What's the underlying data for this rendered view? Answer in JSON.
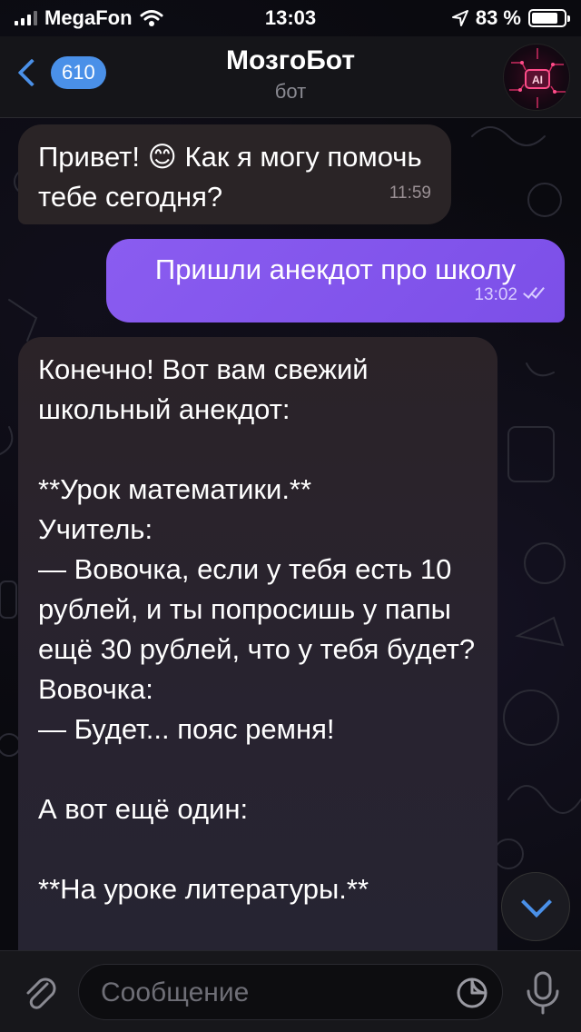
{
  "status_bar": {
    "carrier": "MegaFon",
    "time": "13:03",
    "battery_percent": "83 %",
    "battery_level": 0.83
  },
  "header": {
    "unread_count": "610",
    "title": "МозгоБот",
    "subtitle": "бот",
    "avatar_icon": "ai-robot-avatar",
    "accent_color": "#4a90e8"
  },
  "messages": [
    {
      "direction": "incoming",
      "text_before_emoji": "Привет! ",
      "emoji": "😊",
      "text_after_emoji": " Как я могу помочь тебе сегодня?",
      "time": "11:59"
    },
    {
      "direction": "outgoing",
      "text": "Пришли анекдот про школу",
      "time": "13:02",
      "status_icon": "double-check-icon"
    },
    {
      "direction": "incoming",
      "text": "Конечно! Вот вам свежий школьный анекдот:\n\n**Урок математики.**\nУчитель:\n— Вовочка, если у тебя есть 10 рублей, и ты попросишь у папы ещё 30 рублей, что у тебя будет?\nВовочка:\n— Будет... пояс ремня!\n\nА вот ещё один:\n\n**На уроке литературы.**"
    }
  ],
  "composer": {
    "placeholder": "Сообщение",
    "value": ""
  },
  "colors": {
    "outgoing_bubble": "#8a5cf0",
    "incoming_bubble": "#2a2426",
    "background": "#0a0a0f"
  }
}
